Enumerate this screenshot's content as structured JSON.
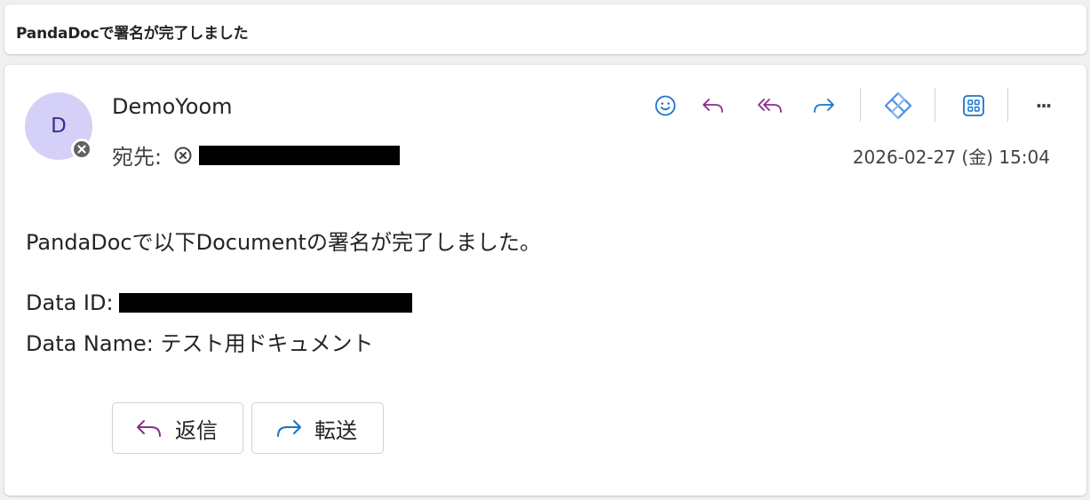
{
  "subject": "PandaDocで署名が完了しました",
  "sender": {
    "name": "DemoYoom",
    "avatar_initial": "D"
  },
  "recipient": {
    "label": "宛先:"
  },
  "date": "2026-02-27 (金) 15:04",
  "toolbar": {
    "icons": [
      "smiley-icon",
      "reply-icon",
      "reply-all-icon",
      "forward-icon",
      "diamond-icon",
      "apps-grid-icon",
      "more-icon"
    ],
    "more_label": "···"
  },
  "body": {
    "line1": "PandaDocで以下Documentの署名が完了しました。",
    "data_id_label": "Data ID:",
    "data_name_line": "Data Name: テスト用ドキュメント"
  },
  "buttons": {
    "reply": "返信",
    "forward": "転送"
  },
  "colors": {
    "avatar_bg": "#d5d0f7",
    "avatar_text": "#3d2f8f",
    "reply_icon": "#8a2c8f",
    "forward_icon": "#1a73c8"
  }
}
